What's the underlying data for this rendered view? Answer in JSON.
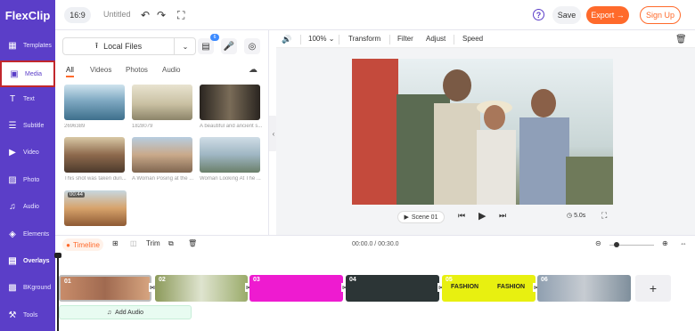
{
  "topbar": {
    "logo": "FlexClip",
    "ratio": "16:9",
    "title": "Untitled",
    "save": "Save",
    "export": "Export →",
    "signup": "Sign Up",
    "help": "?"
  },
  "sidebar": {
    "items": [
      {
        "label": "Templates",
        "icon": "▦"
      },
      {
        "label": "Media",
        "icon": "▣"
      },
      {
        "label": "Text",
        "icon": "T"
      },
      {
        "label": "Subtitle",
        "icon": "☰"
      },
      {
        "label": "Video",
        "icon": "▶"
      },
      {
        "label": "Photo",
        "icon": "▨"
      },
      {
        "label": "Audio",
        "icon": "♫"
      },
      {
        "label": "Elements",
        "icon": "◈"
      },
      {
        "label": "Overlays",
        "icon": "▤"
      },
      {
        "label": "BKground",
        "icon": "▩"
      },
      {
        "label": "Tools",
        "icon": "⚒"
      }
    ]
  },
  "panel": {
    "local_files": "Local Files",
    "badge": "6",
    "tabs": [
      "All",
      "Videos",
      "Photos",
      "Audio"
    ],
    "thumbs": [
      {
        "caption": "2696389"
      },
      {
        "caption": "1828079"
      },
      {
        "caption": "A beautiful and ancient s..."
      },
      {
        "caption": "This shot was taken duri..."
      },
      {
        "caption": "A Woman Posing at the ..."
      },
      {
        "caption": "Woman Looking At The ..."
      },
      {
        "caption": "",
        "duration": "00:44"
      }
    ]
  },
  "preview_toolbar": {
    "zoom": "100%",
    "items": [
      "Transform",
      "Filter",
      "Adjust",
      "Speed"
    ]
  },
  "preview": {
    "scene": "Scene 01",
    "duration": "5.0s"
  },
  "timeline": {
    "label": "Timeline",
    "trim": "Trim",
    "time": "00:00.0 / 00:30.0",
    "clips": [
      "01",
      "02",
      "03",
      "04",
      "05",
      "06"
    ],
    "clip_text": [
      "FASHION",
      "FASHION"
    ],
    "add_audio": "Add Audio"
  }
}
